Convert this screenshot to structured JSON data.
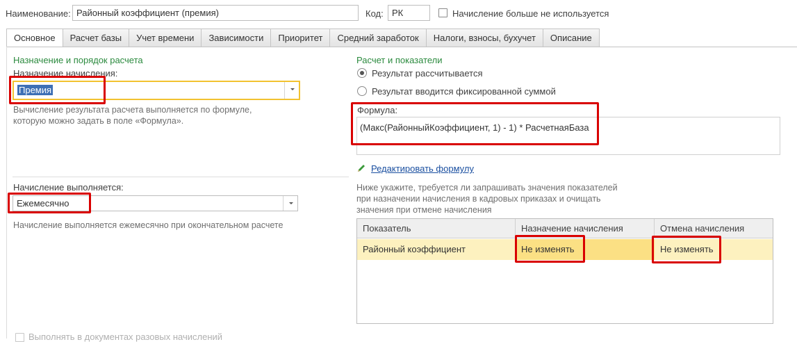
{
  "header": {
    "name_label": "Наименование:",
    "name_value": "Районный коэффициент (премия)",
    "code_label": "Код:",
    "code_value": "РК",
    "unused_label": "Начисление больше не используется"
  },
  "tabs": [
    {
      "label": "Основное",
      "active": true
    },
    {
      "label": "Расчет базы"
    },
    {
      "label": "Учет времени"
    },
    {
      "label": "Зависимости"
    },
    {
      "label": "Приоритет"
    },
    {
      "label": "Средний заработок"
    },
    {
      "label": "Налоги, взносы, бухучет"
    },
    {
      "label": "Описание"
    }
  ],
  "left": {
    "section_title": "Назначение и порядок расчета",
    "purpose_label": "Назначение начисления:",
    "purpose_value": "Премия",
    "purpose_hint_1": "Вычисление результата расчета выполняется по формуле,",
    "purpose_hint_2": "которую можно задать в поле «Формула».",
    "period_label": "Начисление выполняется:",
    "period_value": "Ежемесячно",
    "period_hint": "Начисление выполняется ежемесячно при окончательном расчете",
    "bottom_checkbox_label": "Выполнять в документах разовых начислений"
  },
  "right": {
    "section_title": "Расчет и показатели",
    "radio_calculated": "Результат рассчитывается",
    "radio_fixed": "Результат вводится фиксированной суммой",
    "formula_label": "Формула:",
    "formula_value": "(Макс(РайонныйКоэффициент, 1) - 1) * РасчетнаяБаза",
    "edit_formula_link": "Редактировать формулу",
    "indicators_hint_1": "Ниже укажите, требуется ли запрашивать значения показателей",
    "indicators_hint_2": "при назначении начисления в кадровых приказах и очищать",
    "indicators_hint_3": "значения при отмене начисления"
  },
  "table": {
    "columns": [
      "Показатель",
      "Назначение начисления",
      "Отмена начисления"
    ],
    "rows": [
      [
        "Районный коэффициент",
        "Не изменять",
        "Не изменять"
      ]
    ]
  },
  "colors": {
    "accent_green": "#2b8a3e",
    "highlight_red": "#d90000",
    "focus_yellow": "#f2c230",
    "row_selected": "#fdf1bf"
  }
}
